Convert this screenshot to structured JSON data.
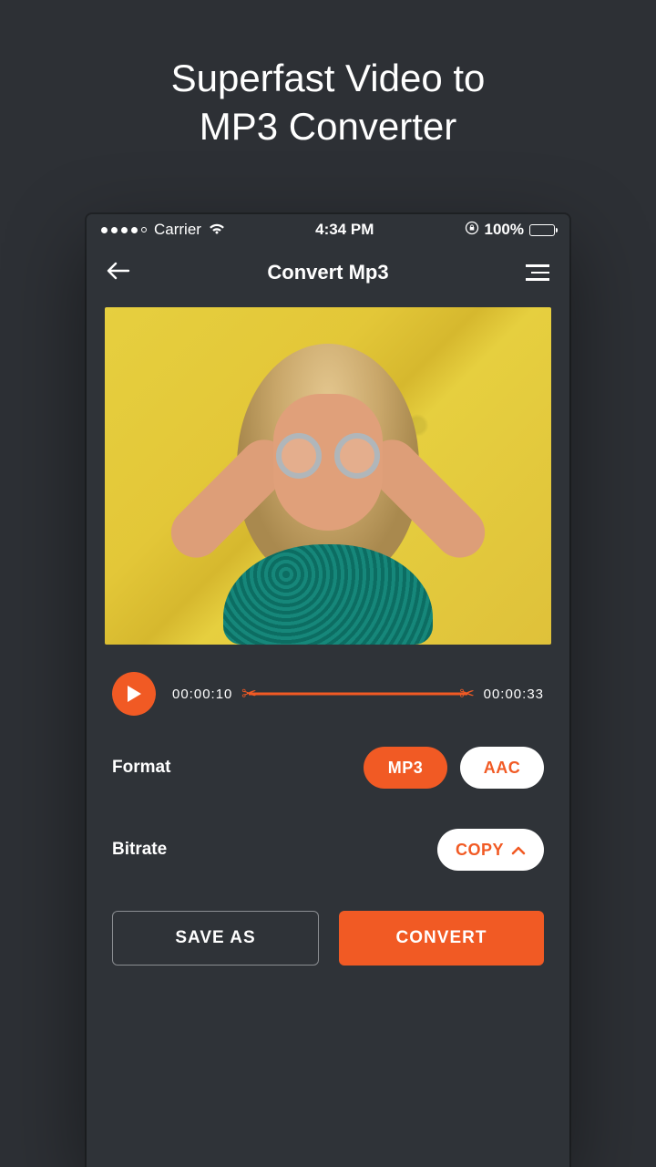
{
  "headline_line1": "Superfast Video to",
  "headline_line2": "MP3 Converter",
  "status": {
    "carrier": "Carrier",
    "time": "4:34 PM",
    "battery": "100%"
  },
  "nav": {
    "title": "Convert Mp3"
  },
  "player": {
    "start_time": "00:00:10",
    "end_time": "00:00:33"
  },
  "format": {
    "label": "Format",
    "options": [
      "MP3",
      "AAC"
    ],
    "selected": "MP3"
  },
  "bitrate": {
    "label": "Bitrate",
    "copy_label": "COPY"
  },
  "actions": {
    "save_as": "SAVE AS",
    "convert": "CONVERT"
  }
}
